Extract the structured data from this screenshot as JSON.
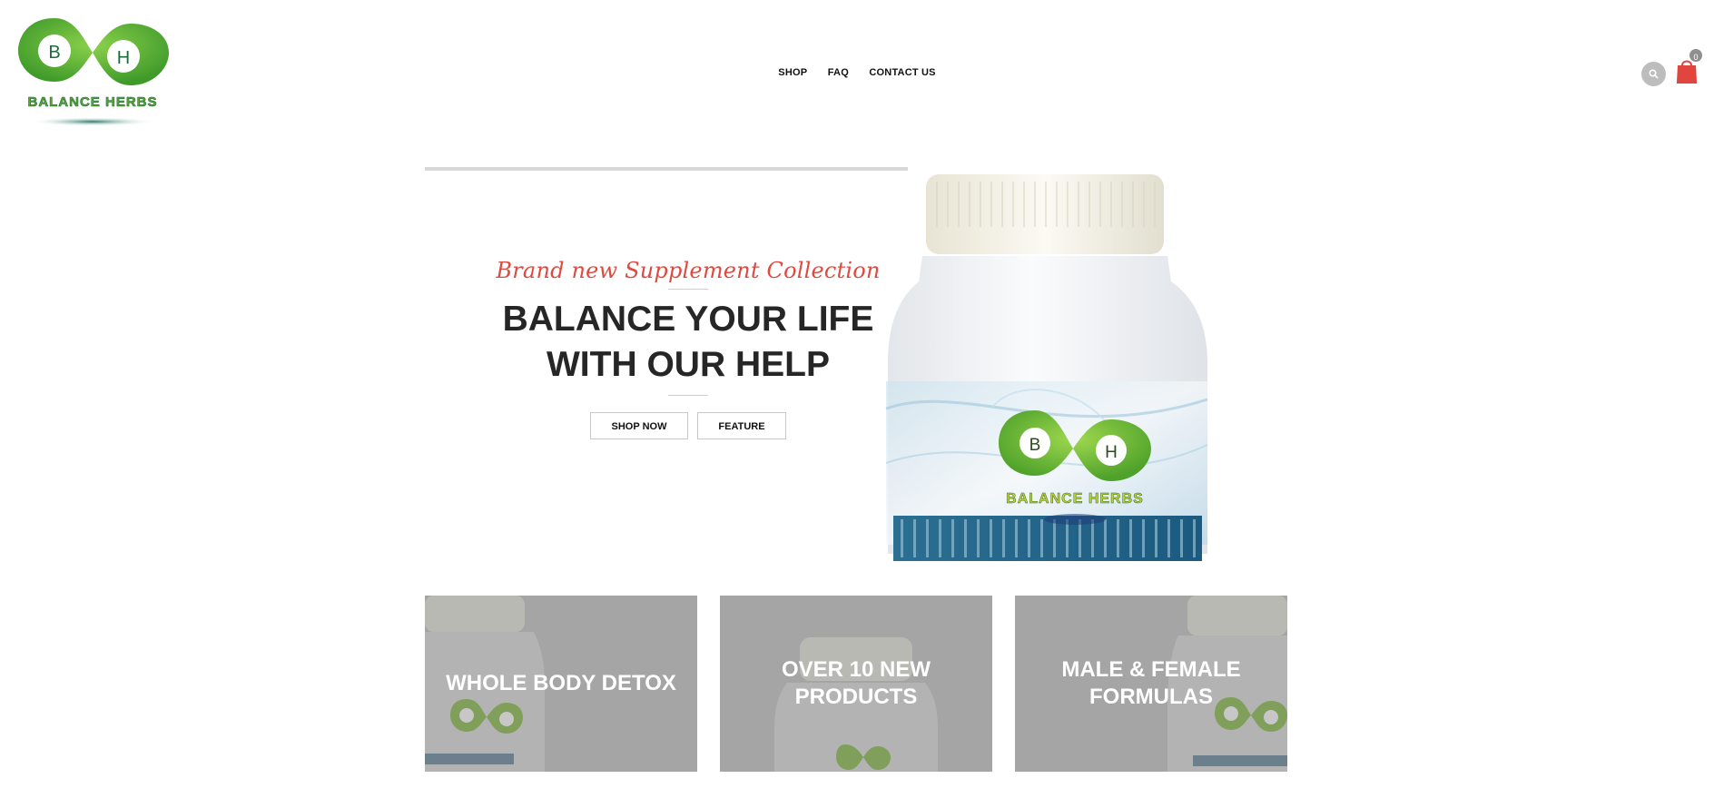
{
  "brand": {
    "logo_letter_left": "B",
    "logo_letter_right": "H",
    "logo_wordmark": "BALANCE HERBS",
    "green": "#5aa832",
    "dark_green": "#1f6b3a",
    "accent_red": "#de4a3f"
  },
  "nav": {
    "items": [
      "SHOP",
      "FAQ",
      "CONTACT US"
    ]
  },
  "header_icons": {
    "search": "search-icon",
    "cart": "shopping-bag-icon",
    "cart_count": "0"
  },
  "hero": {
    "tagline": "Brand new Supplement Collection",
    "headline_line1": "BALANCE YOUR LIFE",
    "headline_line2": "WITH OUR HELP",
    "primary_button": "SHOP NOW",
    "secondary_button": "FEATURE",
    "jar_logo_text": "BALANCE HERBS"
  },
  "tiles": [
    {
      "label": "WHOLE BODY DETOX"
    },
    {
      "label": "OVER 10 NEW PRODUCTS"
    },
    {
      "label": "MALE & FEMALE FORMULAS"
    }
  ]
}
